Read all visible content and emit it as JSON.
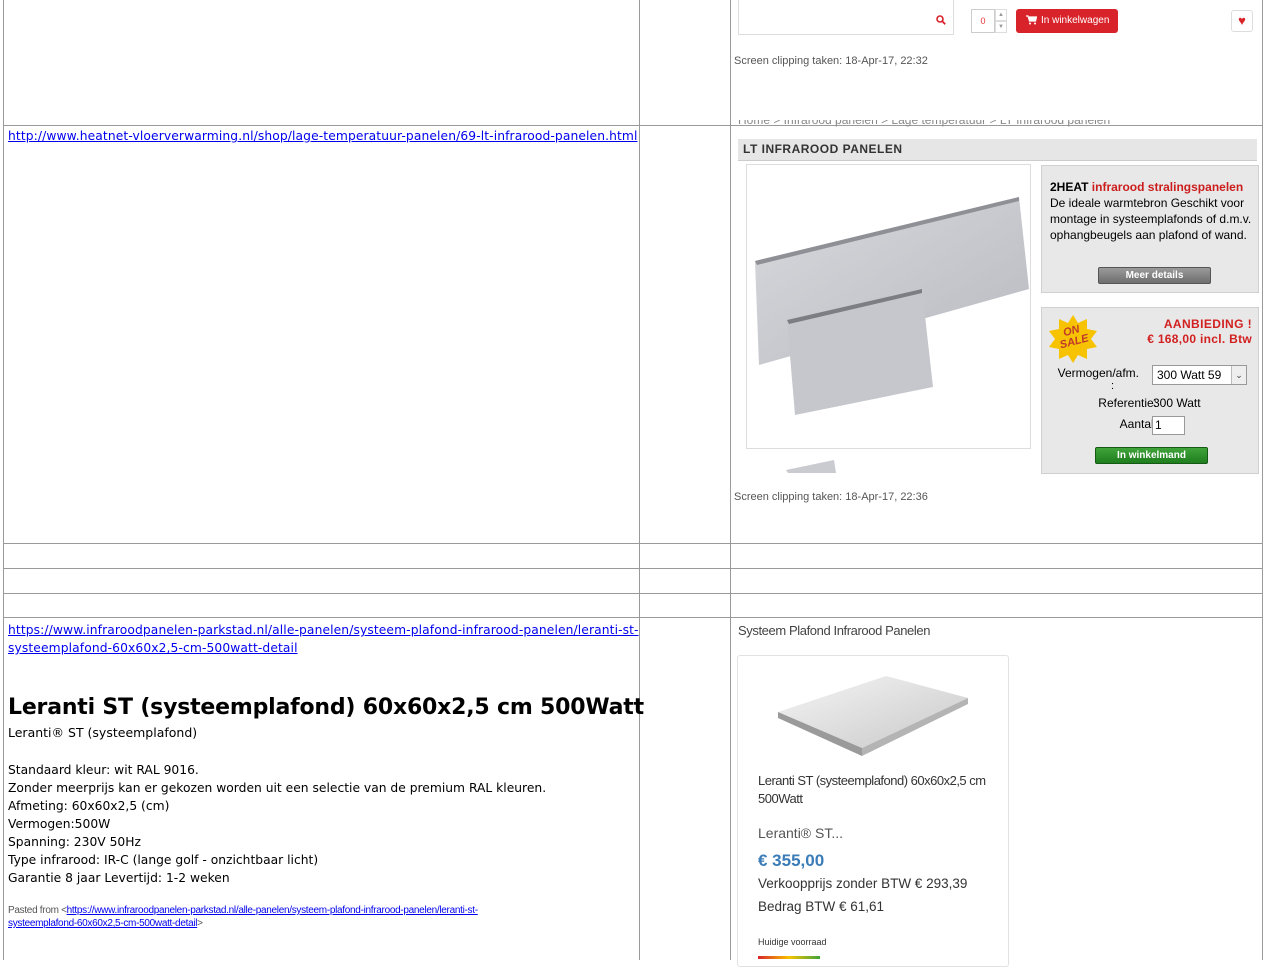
{
  "top_clip": {
    "qty_value": "0",
    "cart_button": "In winkelwagen",
    "clipping_note": "Screen clipping taken: 18-Apr-17, 22:32"
  },
  "row2": {
    "url": "http://www.heatnet-vloerverwarming.nl/shop/lage-temperatuur-panelen/69-lt-infrarood-panelen.html",
    "breadcrumb": "Home  >  Infrarood panelen  >  Lage temperatuur  >  LT Infrarood panelen",
    "section_title": "LT INFRAROOD PANELEN",
    "info_brand": "2HEAT ",
    "info_highlight": "infrarood stralingspanelen",
    "info_text": "De ideale warmtebron Geschikt voor montage in systeemplafonds of d.m.v. ophangbeugels aan plafond of wand.",
    "details_button": "Meer details",
    "sale_badge_line1": "ON",
    "sale_badge_line2": "SALE",
    "offer_label": "AANBIEDING !",
    "offer_price": "€ 168,00 incl. Btw",
    "power_label": "Vermogen/afm.",
    "power_colon": ":",
    "power_value": "300 Watt 59",
    "ref_label": "Referentie:",
    "ref_value": "300 Watt",
    "qty_label": "Aantal:",
    "qty_value": "1",
    "order_button": "In winkelmand",
    "clipping_note": "Screen clipping taken: 18-Apr-17, 22:36"
  },
  "row3": {
    "url_line1": "https://www.infraroodpanelen-parkstad.nl/alle-panelen/systeem-plafond-infrarood-panelen/leranti-st-",
    "url_line2": "systeemplafond-60x60x2,5-cm-500watt-detail",
    "heading": "Leranti ST (systeemplafond) 60x60x2,5 cm 500Watt",
    "subheading": "Leranti® ST (systeemplafond)",
    "specs": [
      "Standaard kleur: wit RAL 9016.",
      "Zonder meerprijs kan er gekozen worden uit een selectie van de premium RAL kleuren.",
      "Afmeting: 60x60x2,5 (cm)",
      "Vermogen:500W",
      "Spanning: 230V 50Hz",
      "Type infrarood: IR-C (lange golf - onzichtbaar licht)",
      "Garantie 8 jaar Levertijd: 1-2 weken"
    ],
    "pasted_prefix": "Pasted from <",
    "pasted_link_line1": "https://www.infraroodpanelen-parkstad.nl/alle-panelen/systeem-plafond-infrarood-panelen/leranti-st-",
    "pasted_link_line2": "systeemplafond-60x60x2,5-cm-500watt-detail",
    "pasted_suffix": ">",
    "category_title": "Systeem Plafond Infrarood Panelen",
    "card_title": "Leranti ST (systeemplafond) 60x60x2,5 cm 500Watt",
    "card_sub": "Leranti® ST...",
    "card_price": "€ 355,00",
    "card_excl": "Verkoopprijs zonder BTW € 293,39",
    "card_vat": "Bedrag BTW € 61,61",
    "stock_label": "Huidige voorraad"
  }
}
